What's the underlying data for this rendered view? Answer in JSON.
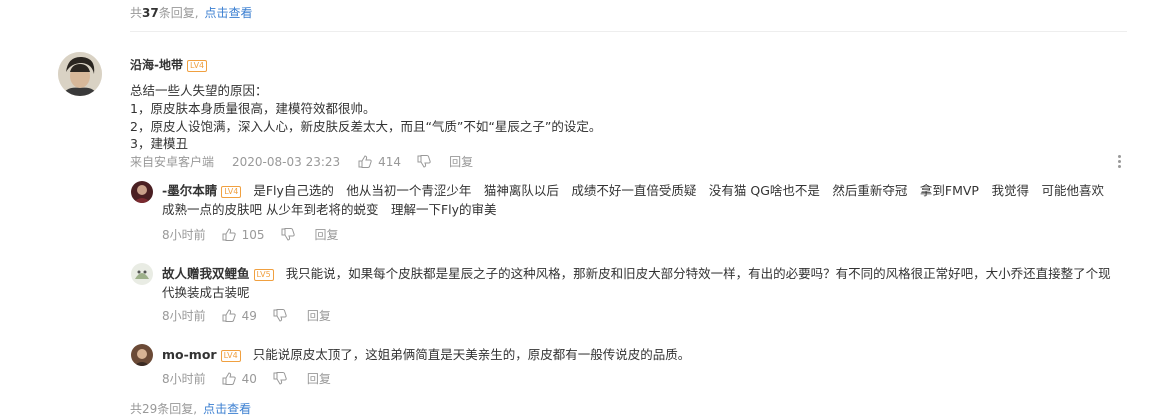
{
  "top_summary": {
    "prefix": "共",
    "count": "37",
    "suffix": "条回复,",
    "link": "点击查看"
  },
  "main_comment": {
    "author": "沿海-地带",
    "level": "LV4",
    "lines": [
      "总结一些人失望的原因：",
      "1，原皮肤本身质量很高，建模符效都很帅。",
      "2，原皮人设饱满，深入人心，新皮肤反差太大，而且“气质”不如“星辰之子”的设定。",
      "3，建模丑"
    ],
    "source": "来自安卓客户端",
    "time": "2020-08-03 23:23",
    "likes": "414",
    "reply_label": "回复"
  },
  "replies": [
    {
      "author": "-墨尔本睛",
      "level": "LV4",
      "text": "是Fly自己选的　他从当初一个青涩少年　猫神离队以后　成绩不好一直倍受质疑　没有猫  QG啥也不是　然后重新夺冠　拿到FMVP　我觉得　可能他喜欢成熟一点的皮肤吧  从少年到老将的蜕变　理解一下Fly的审美",
      "time": "8小时前",
      "likes": "105",
      "reply_label": "回复"
    },
    {
      "author": "故人赠我双鲤鱼",
      "level": "LV5",
      "text": "我只能说，如果每个皮肤都是星辰之子的这种风格，那新皮和旧皮大部分特效一样，有出的必要吗？有不同的风格很正常好吧，大小乔还直接整了个现代换装成古装呢",
      "time": "8小时前",
      "likes": "49",
      "reply_label": "回复"
    },
    {
      "author": "mo-mor",
      "level": "LV4",
      "text": "只能说原皮太顶了，这姐弟俩简直是天美亲生的，原皮都有一般传说皮的品质。",
      "time": "8小时前",
      "likes": "40",
      "reply_label": "回复"
    }
  ],
  "bottom_summary": {
    "prefix": "共",
    "count": "29",
    "suffix": "条回复,",
    "link": "点击查看"
  }
}
